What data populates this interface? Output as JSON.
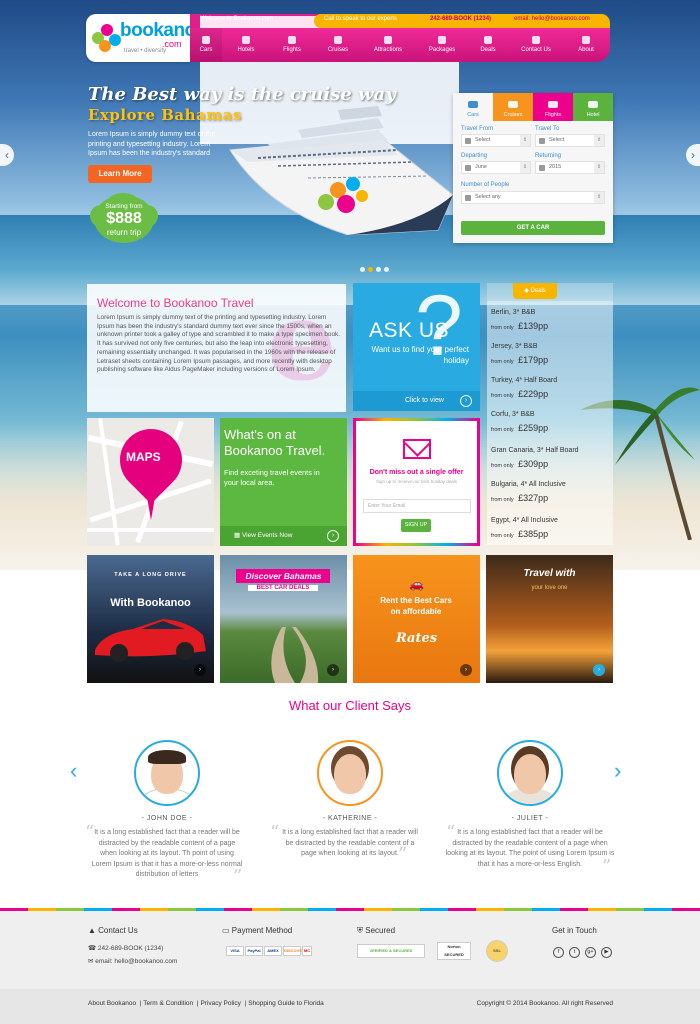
{
  "header": {
    "logo_text": "bookanoo",
    "logo_com": ".com",
    "logo_tagline": "travel • diversity",
    "welcome": "Welcome to Bookanoo.com",
    "call_label": "Call to speak to our experts",
    "phone": "242-689-BOOK (1234)",
    "email": "email: hello@bookanoo.com",
    "nav": [
      "Cars",
      "Hotels",
      "Flights",
      "Cruises",
      "Attractions",
      "Packages",
      "Deals",
      "Contact Us",
      "About"
    ]
  },
  "hero": {
    "title": "The Best way is the cruise way",
    "subtitle": "Explore Bahamas",
    "desc": "Lorem Ipsum is simply dummy text of the printing and typesetting industry. Lorem Ipsum has been the industry's standard",
    "button": "Learn More",
    "badge_line1": "Starting from",
    "badge_price": "$888",
    "badge_line3": "return trip"
  },
  "search": {
    "tabs": [
      "Cars",
      "Cruises",
      "Flights",
      "Hotel"
    ],
    "travel_from": "Travel From",
    "travel_to": "Travel To",
    "select": "Select",
    "departing": "Departing",
    "returning": "Returning",
    "depart_value": "June",
    "return_value": "2015",
    "people_label": "Number of People",
    "people_value": "Select any",
    "button": "GET A CAR"
  },
  "welcome": {
    "title": "Welcome to Bookanoo Travel",
    "body": "Lorem Ipsum is simply dummy text of the printing and typesetting industry. Lorem Ipsum has been the industry's standard dummy text ever since the 1500s, when an unknown printer took a galley of type and scrambled it to make a type specimen book. It has survived not only five centuries, but also the leap into electronic typesetting, remaining essentially unchanged. It was popularised in the 1960s with the release of Letraset sheets containing Lorem Ipsum passages, and more recently with desktop publishing software like Aldus PageMaker including versions of Lorem Ipsum."
  },
  "askus": {
    "title": "ASK US",
    "sub": "Want us to find your perfect holiday",
    "link": "Click to view"
  },
  "deals": {
    "tab": "Deals",
    "from": "from only",
    "items": [
      {
        "name": "Berlin, 3* B&B",
        "price": "£139pp"
      },
      {
        "name": "Jersey, 3* B&B",
        "price": "£179pp"
      },
      {
        "name": "Turkey, 4* Half Board",
        "price": "£229pp"
      },
      {
        "name": "Corfu, 3* B&B",
        "price": "£259pp"
      },
      {
        "name": "Gran Canaria, 3* Half Board",
        "price": "£309pp"
      },
      {
        "name": "Bulgaria, 4* All Inclusive",
        "price": "£327pp"
      },
      {
        "name": "Egypt, 4* All Inclusive",
        "price": "£385pp"
      }
    ]
  },
  "maps": {
    "label": "MAPS"
  },
  "whats": {
    "title": "What's on at Bookanoo Travel.",
    "desc": "Find exceting travel events in your local area.",
    "link": "View Events Now"
  },
  "newsletter": {
    "title": "Don't miss out a single offer",
    "sub": "Sign up to receive our best holiday deals",
    "placeholder": "Enter Your Email",
    "button": "SIGN UP"
  },
  "promos": [
    {
      "line1": "TAKE A LONG DRIVE",
      "line2": "With Bookanoo"
    },
    {
      "line1": "Discover Bahamas",
      "line2": "BEST CAR DEALS"
    },
    {
      "line1": "Rent the Best Cars on affordable",
      "line2": "Rates"
    },
    {
      "line1": "Travel with",
      "line2": "your love one"
    }
  ],
  "clients": {
    "heading": "What our Client Says",
    "items": [
      {
        "name": "- JOHN DOE -",
        "quote": "It is a long established fact that a reader will be distracted by the readable content of a page when looking at its layout. Th point of using Lorem Ipsum is that it has a more-or-less normal distribution of letters"
      },
      {
        "name": "- KATHERINE -",
        "quote": "It is a long established fact that a reader will be distracted by the readable content of a page when looking at its layout."
      },
      {
        "name": "- JULIET -",
        "quote": "It is a long established fact that a reader will be distracted by the readable content of a page when looking at its layout. The point of using Lorem Ipsum is that it has a more-or-less English."
      }
    ]
  },
  "footer": {
    "contact_title": "Contact Us",
    "phone": "242-689-BOOK (1234)",
    "email": "email: hello@bookanoo.com",
    "payment_title": "Payment Method",
    "payments": [
      "VISA",
      "PayPal",
      "AMEX",
      "DISCOVER",
      "MC"
    ],
    "secured_title": "Secured",
    "secured_badges": [
      "VERIFIED & SECURED",
      "Norton SECURED",
      "SSL"
    ],
    "touch_title": "Get in Touch",
    "social": [
      "f",
      "t",
      "g+",
      "▶"
    ],
    "links": [
      "About Bookanoo",
      "Term & Condition",
      "Privacy Policy",
      "Shopping Guide to Florida"
    ],
    "copyright": "Copyright © 2014 Bookanoo. All right Reserved"
  },
  "colors": {
    "pink": "#ec008c",
    "orange": "#f8b500",
    "green": "#5cb840",
    "blue": "#29abe2"
  }
}
